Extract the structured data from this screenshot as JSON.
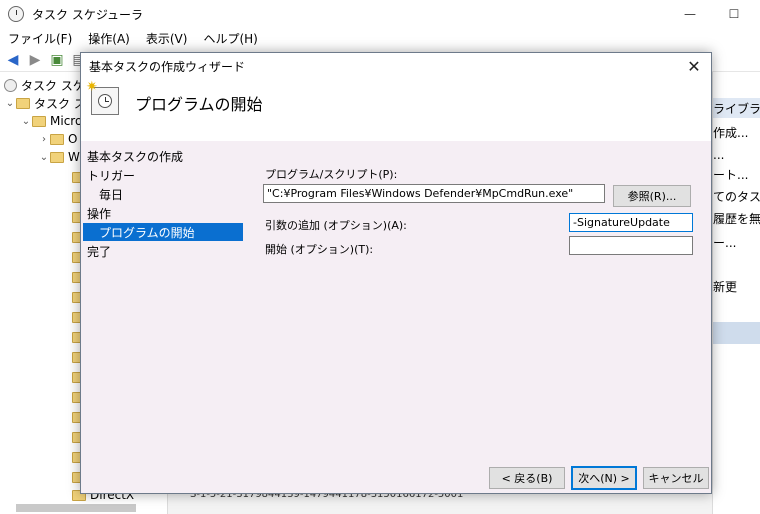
{
  "main_window": {
    "title": "タスク スケジューラ",
    "minimize": "—",
    "maximize": "☐",
    "menu": [
      "ファイル(F)",
      "操作(A)",
      "表示(V)",
      "ヘルプ(H)"
    ],
    "tree": {
      "root": "タスク スケジュ",
      "library": "タスク スケ",
      "microsoft": "Micro",
      "c_item": "O",
      "w_item": "W",
      "directx": "DirectX"
    },
    "actions": {
      "header": "ライブラリ",
      "items": [
        "作成...",
        "...",
        "ート...",
        "てのタスク...",
        "履歴を無...",
        "ー...",
        "新更"
      ]
    },
    "bottom_text": "S-1-5-21-3179844139-1479441178-3150166172-5001"
  },
  "dialog": {
    "title": "基本タスクの作成ウィザード",
    "close": "✕",
    "heading": "プログラムの開始",
    "steps": [
      {
        "label": "基本タスクの作成"
      },
      {
        "label": "トリガー"
      },
      {
        "label": "毎日"
      },
      {
        "label": "操作"
      },
      {
        "label": "プログラムの開始"
      },
      {
        "label": "完了"
      }
    ],
    "program": {
      "label": "プログラム/スクリプト(P):",
      "value": "\"C:¥Program Files¥Windows Defender¥MpCmdRun.exe\"",
      "browse": "参照(R)..."
    },
    "arguments": {
      "label": "引数の追加 (オプション)(A):",
      "value": "-SignatureUpdate"
    },
    "start_in": {
      "label": "開始 (オプション)(T):",
      "value": ""
    },
    "buttons": {
      "back": "< 戻る(B)",
      "next": "次へ(N) >",
      "cancel": "キャンセル"
    }
  }
}
